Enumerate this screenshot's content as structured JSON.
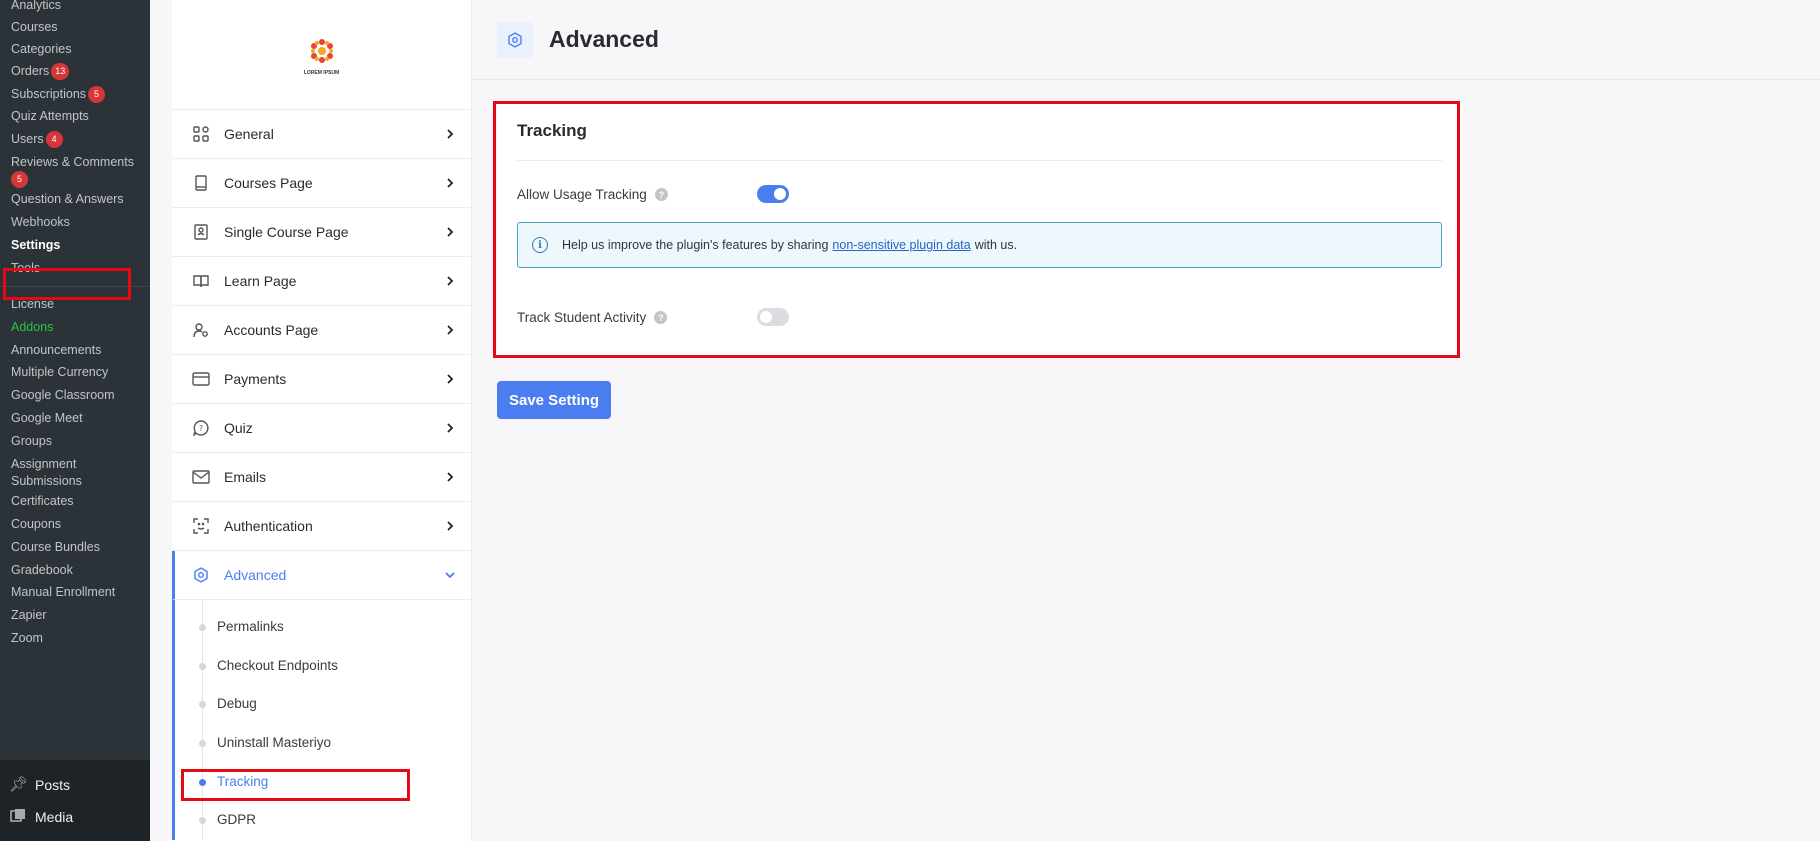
{
  "wp_menu": {
    "items": [
      {
        "label": "Analytics"
      },
      {
        "label": "Courses"
      },
      {
        "label": "Categories"
      },
      {
        "label": "Orders",
        "badge": "13"
      },
      {
        "label": "Subscriptions",
        "badge": "5"
      },
      {
        "label": "Quiz Attempts"
      },
      {
        "label": "Users",
        "badge": "4"
      },
      {
        "label": "Reviews & Comments",
        "badge": "5"
      },
      {
        "label": "Question & Answers"
      },
      {
        "label": "Webhooks"
      },
      {
        "label": "Settings"
      },
      {
        "label": "Tools"
      },
      {
        "label": "License"
      },
      {
        "label": "Addons"
      },
      {
        "label": "Announcements"
      },
      {
        "label": "Multiple Currency"
      },
      {
        "label": "Google Classroom"
      },
      {
        "label": "Google Meet"
      },
      {
        "label": "Groups"
      },
      {
        "label": "Assignment"
      },
      {
        "label": "Submissions"
      },
      {
        "label": "Certificates"
      },
      {
        "label": "Coupons"
      },
      {
        "label": "Course Bundles"
      },
      {
        "label": "Gradebook"
      },
      {
        "label": "Manual Enrollment"
      },
      {
        "label": "Zapier"
      },
      {
        "label": "Zoom"
      }
    ],
    "main_items": [
      {
        "label": "Posts",
        "icon": "pin-icon"
      },
      {
        "label": "Media",
        "icon": "media-icon"
      }
    ]
  },
  "settings_nav": {
    "logo_text": "LOREM IPSUM",
    "items": [
      {
        "label": "General",
        "icon": "grid-icon"
      },
      {
        "label": "Courses Page",
        "icon": "book-icon"
      },
      {
        "label": "Single Course Page",
        "icon": "badge-icon"
      },
      {
        "label": "Learn Page",
        "icon": "open-book-icon"
      },
      {
        "label": "Accounts Page",
        "icon": "user-gear-icon"
      },
      {
        "label": "Payments",
        "icon": "card-icon"
      },
      {
        "label": "Quiz",
        "icon": "chat-question-icon"
      },
      {
        "label": "Emails",
        "icon": "mail-icon"
      },
      {
        "label": "Authentication",
        "icon": "scan-face-icon"
      },
      {
        "label": "Advanced",
        "icon": "gear-hex-icon"
      }
    ],
    "sub_items": [
      {
        "label": "Permalinks"
      },
      {
        "label": "Checkout Endpoints"
      },
      {
        "label": "Debug"
      },
      {
        "label": "Uninstall Masteriyo"
      },
      {
        "label": "Tracking"
      },
      {
        "label": "GDPR"
      }
    ]
  },
  "header": {
    "title": "Advanced"
  },
  "tracking_card": {
    "title": "Tracking",
    "allow_usage": {
      "label": "Allow Usage Tracking",
      "enabled": true
    },
    "info": {
      "prefix": "Help us improve the plugin's features by sharing",
      "link": "non-sensitive plugin data",
      "suffix": "with us."
    },
    "track_student": {
      "label": "Track Student Activity",
      "enabled": false
    }
  },
  "save_button": "Save Setting",
  "colors": {
    "accent": "#4a7ef0",
    "highlight": "#e50914",
    "addons": "#28c63d"
  }
}
